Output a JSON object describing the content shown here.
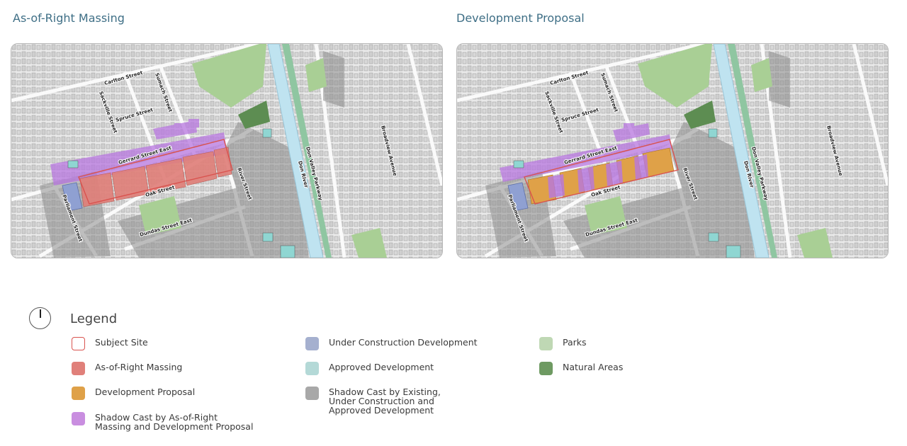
{
  "panels": {
    "left": {
      "title": "As-of-Right Massing"
    },
    "right": {
      "title": "Development Proposal"
    }
  },
  "streets": {
    "carlton": "Carlton Street",
    "sackville": "Sackville Street",
    "sumach": "Sumach Street",
    "spruce": "Spruce Street",
    "gerrard": "Gerrard Street East",
    "oak": "Oak Street",
    "river": "River Street",
    "parliament": "Parliament Street",
    "dundas": "Dundas Street East",
    "dvp": "Don Valley Parkway",
    "don_river": "Don River",
    "broadview": "Broadview Avenue"
  },
  "legend": {
    "title": "Legend",
    "items": [
      {
        "label": "Subject Site",
        "color": "#ffffff",
        "border": "#d9534f",
        "icon": "outline-square"
      },
      {
        "label": "As-of-Right Massing",
        "color": "#e0807a"
      },
      {
        "label": "Development Proposal",
        "color": "#dfa148"
      },
      {
        "label": "Shadow Cast by As-of-Right Massing and Development Proposal",
        "color": "#c98ee0"
      },
      {
        "label": "Under Construction Development",
        "color": "#a5b0cf"
      },
      {
        "label": "Approved Development",
        "color": "#b4d9d7"
      },
      {
        "label": "Shadow Cast by Existing, Under Construction and Approved Development",
        "color": "#a8a8a8"
      },
      {
        "label": "Parks",
        "color": "#bfd8b4"
      },
      {
        "label": "Natural Areas",
        "color": "#6e9a62"
      }
    ]
  },
  "colors": {
    "shadow_grey": "#8c8c8c",
    "park": "#a9cf95",
    "natural": "#5d8d52",
    "river": "#bfe3f0",
    "site": "#d9534f"
  }
}
